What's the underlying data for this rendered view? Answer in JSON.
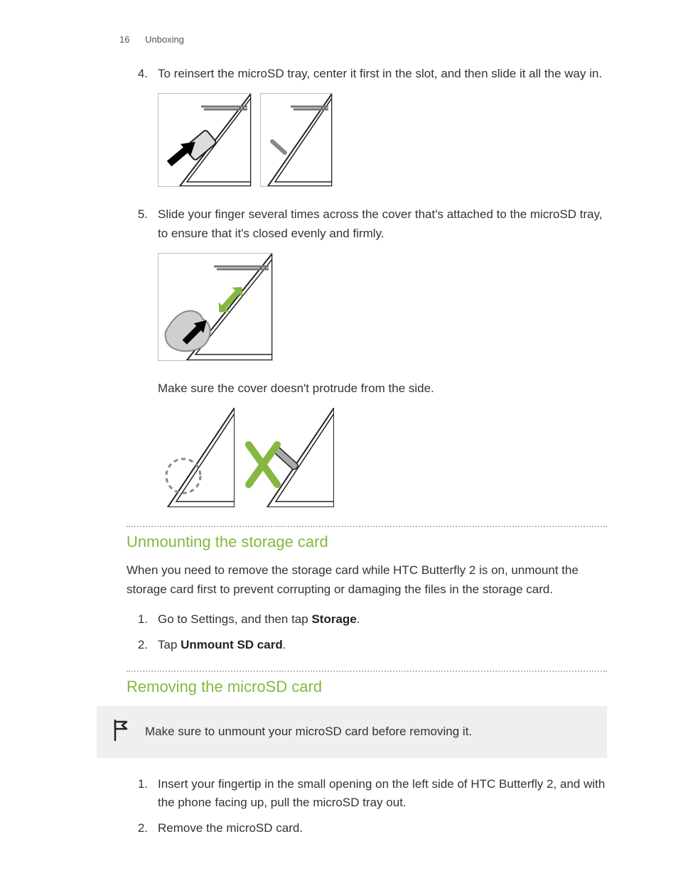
{
  "header": {
    "page_number": "16",
    "section": "Unboxing"
  },
  "steps_a": [
    {
      "n": "4.",
      "text": "To reinsert the microSD tray, center it first in the slot, and then slide it all the way in."
    },
    {
      "n": "5.",
      "text": "Slide your finger several times across the cover that's attached to the microSD tray, to ensure that it's closed evenly and firmly."
    }
  ],
  "after5_note": "Make sure the cover doesn't protrude from the side.",
  "section_unmount": {
    "heading": "Unmounting the storage card",
    "intro": "When you need to remove the storage card while HTC Butterfly 2 is on, unmount the storage card first to prevent corrupting or damaging the files in the storage card.",
    "steps": [
      {
        "n": "1.",
        "plain1": "Go to Settings, and then tap ",
        "bold": "Storage",
        "plain2": "."
      },
      {
        "n": "2.",
        "plain1": "Tap ",
        "bold": "Unmount SD card",
        "plain2": "."
      }
    ]
  },
  "section_remove": {
    "heading": "Removing the microSD card",
    "callout": "Make sure to unmount your microSD card before removing it.",
    "steps": [
      {
        "n": "1.",
        "text": "Insert your fingertip in the small opening on the left side of HTC Butterfly 2, and with the phone facing up, pull the microSD tray out."
      },
      {
        "n": "2.",
        "text": "Remove the microSD card."
      }
    ]
  },
  "icons": {
    "flag": "flag-icon"
  },
  "colors": {
    "accent": "#84b840",
    "rule": "#bbbbbb",
    "callout_bg": "#efefef"
  }
}
